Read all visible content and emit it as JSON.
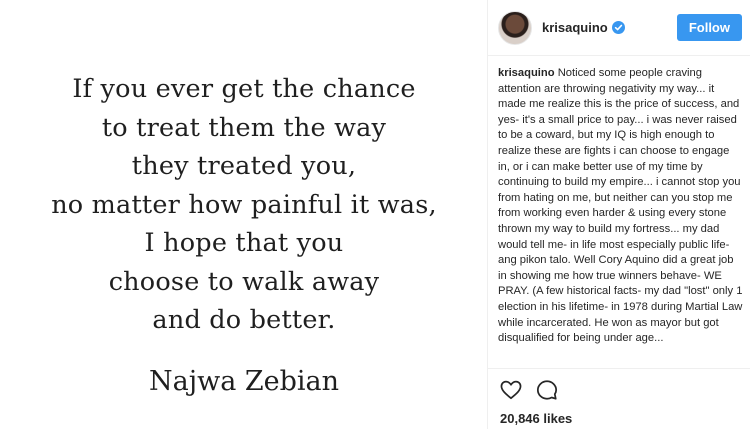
{
  "image": {
    "quote_lines": [
      "If you ever get the chance",
      "to treat them the way",
      "they treated you,",
      "no matter how painful it was,",
      "I hope that you",
      "choose to walk away",
      "and do better."
    ],
    "author": "Najwa Zebian"
  },
  "header": {
    "username": "krisaquino",
    "follow_label": "Follow",
    "accent_color": "#3897f0"
  },
  "caption": {
    "username": "krisaquino",
    "text": "Noticed some people craving attention are throwing negativity my way... it made me realize this is the price of success, and yes- it's a small price to pay... i was never raised to be a coward, but my IQ is high enough to realize these are fights i can choose to engage in, or i can make better use of my time by continuing to build my empire... i cannot stop you from hating on me, but neither can you stop me from working even harder & using every stone thrown my way to build my fortress... my dad would tell me- in life most especially public life- ang pikon talo. Well Cory Aquino did a great job in showing me how true winners behave- WE PRAY. (A few historical facts- my dad \"lost\" only 1 election in his lifetime- in 1978 during Martial Law while incarcerated. He won as mayor but got disqualified for being under age..."
  },
  "actions": {
    "icons": [
      "heart-icon",
      "comment-icon"
    ],
    "likes": "20,846 likes"
  }
}
